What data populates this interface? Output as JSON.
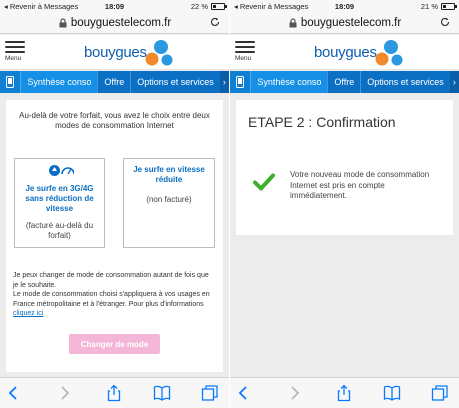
{
  "colors": {
    "brand_blue": "#0b6fc4",
    "active_tab": "#1590e6",
    "pink_button": "#f4b6d6",
    "check_green": "#3fae2f"
  },
  "screens": [
    {
      "status": {
        "back": "◂ Revenir à Messages",
        "time": "18:09",
        "battery": "22 %",
        "battery_level": 0.22
      },
      "url": "bouyguestelecom.fr",
      "menu_label": "Menu",
      "logo": "bouygues",
      "tabs": [
        "Synthèse conso",
        "Offre",
        "Options et services"
      ],
      "intro": "Au-delà de votre forfait, vous avez le choix entre deux modes de consommation Internet",
      "choice1": {
        "title": "Je surfe en 3G/4G sans réduction de vitesse",
        "sub": "(facturé au-delà du forfait)",
        "icon": "speed-gauge-icon"
      },
      "choice2": {
        "title": "Je surfe en vitesse réduite",
        "sub": "(non facturé)"
      },
      "body_line1": "Je peux changer de mode de consommation autant de fois que je le souhaite.",
      "body_line2": "Le mode de consommation choisi s'appliquera à vos usages en France métropolitaine et à l'étranger. Pour plus d'informations",
      "link": "cliquez ici",
      "button": "Changer de mode"
    },
    {
      "status": {
        "back": "◂ Revenir à Messages",
        "time": "18:09",
        "battery": "21 %",
        "battery_level": 0.21
      },
      "url": "bouyguestelecom.fr",
      "menu_label": "Menu",
      "logo": "bouygues",
      "tabs": [
        "Synthèse conso",
        "Offre",
        "Options et services"
      ],
      "step_title": "ETAPE 2 : Confirmation",
      "confirm_text": "Votre nouveau mode de consommation Internet est pris en compte immédiatement."
    }
  ]
}
